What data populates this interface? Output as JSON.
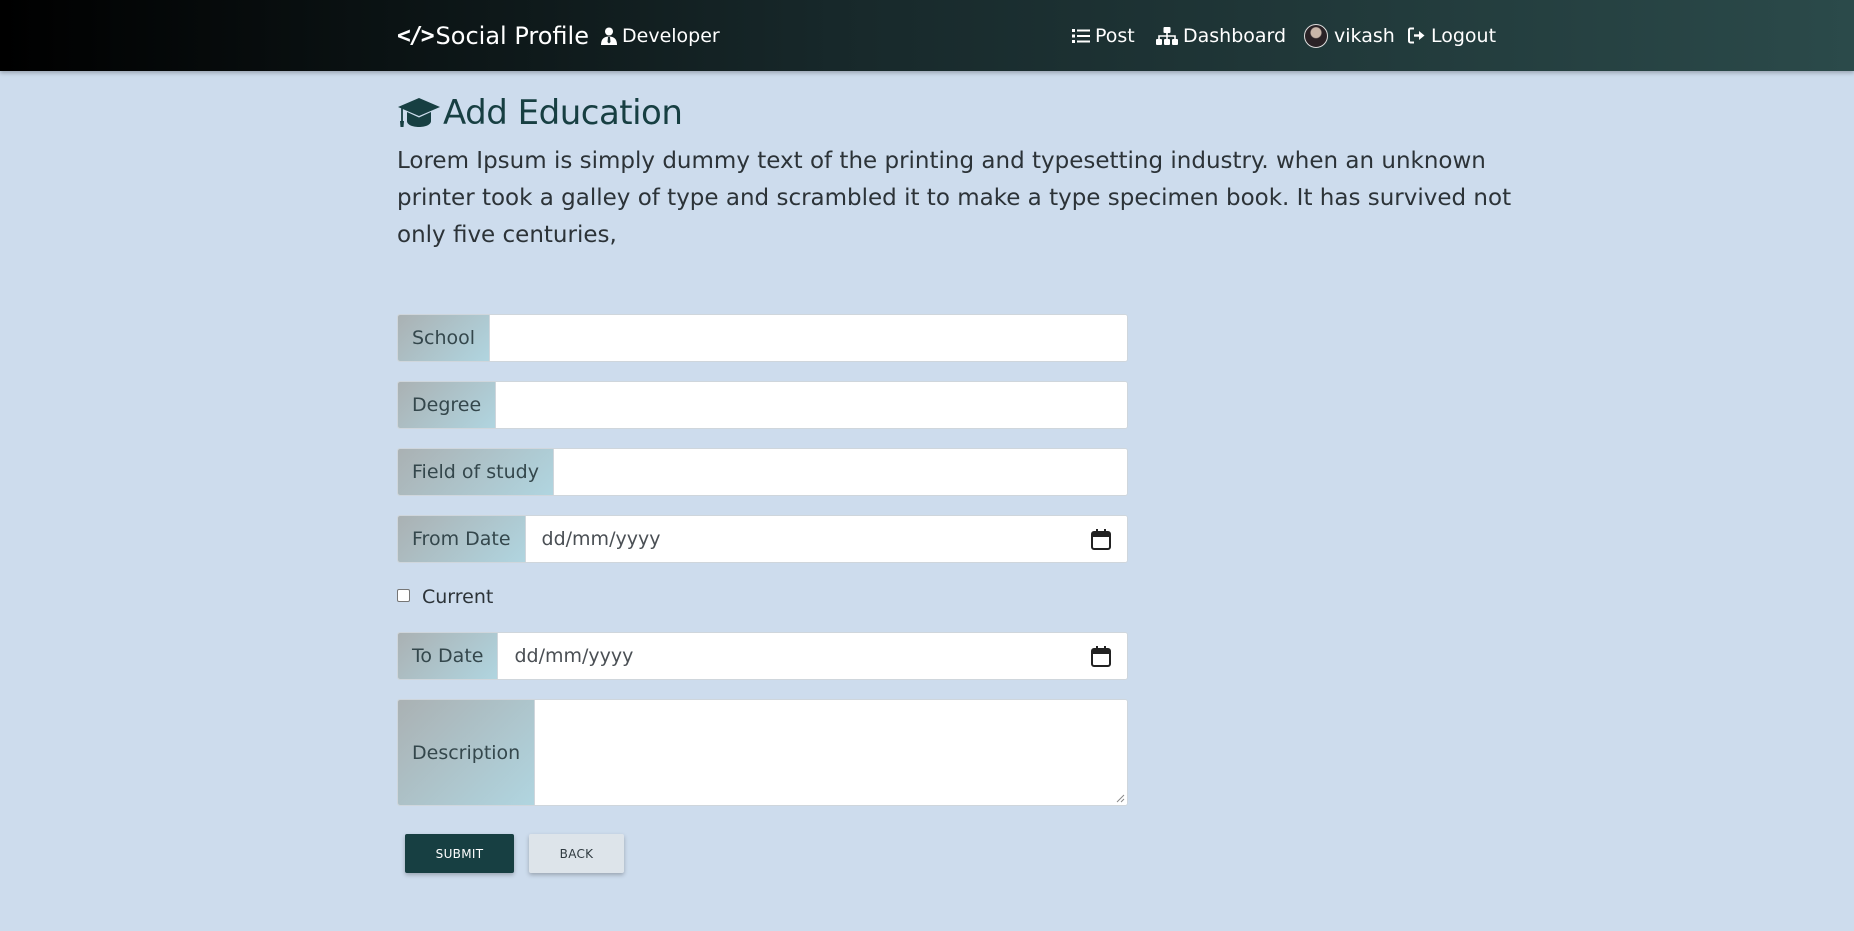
{
  "navbar": {
    "brand_icon": "</>",
    "brand_label": "Social Profile",
    "developer_label": "Developer",
    "post_label": "Post",
    "dashboard_label": "Dashboard",
    "user_label": "vikash",
    "logout_label": "Logout",
    "icons": {
      "developer": "user-tie-icon",
      "post": "list-icon",
      "dashboard": "sitemap-icon",
      "user": "avatar",
      "logout": "sign-out-icon"
    }
  },
  "page": {
    "title": "Add Education",
    "title_icon": "graduation-cap-icon",
    "lead": "Lorem Ipsum is simply dummy text of the printing and typesetting industry. when an unknown printer took a galley of type and scrambled it to make a type specimen book. It has survived not only five centuries,"
  },
  "form": {
    "school_label": "School",
    "school_value": "",
    "degree_label": "Degree",
    "degree_value": "",
    "field_label": "Field of study",
    "field_value": "",
    "from_label": "From Date",
    "from_placeholder": "dd/mm/yyyy",
    "current_label": "Current",
    "current_checked": false,
    "to_label": "To Date",
    "to_placeholder": "dd/mm/yyyy",
    "description_label": "Description",
    "description_value": "",
    "submit_label": "SUBMIT",
    "back_label": "BACK"
  },
  "colors": {
    "background": "#cddced",
    "accent": "#173f42",
    "navbar_start": "#000000",
    "navbar_end": "#2b4a4a"
  }
}
